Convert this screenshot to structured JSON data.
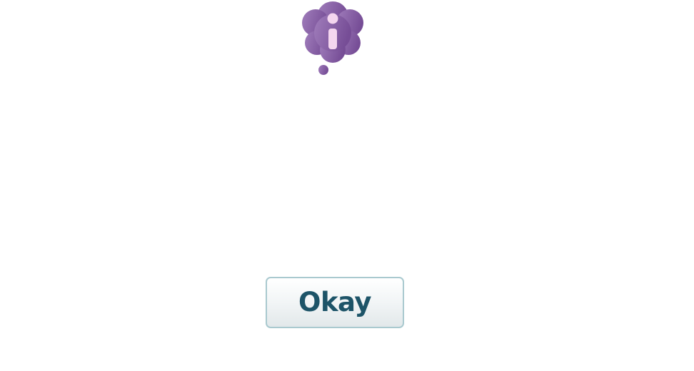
{
  "dialog": {
    "icon": "info-thought-bubble-icon",
    "message": "",
    "button_label": "Okay"
  },
  "colors": {
    "bubble_purple": "#8a5fa8",
    "bubble_dot": "#f4d6ef",
    "button_text": "#1d5468",
    "button_border": "#a9c9cf"
  }
}
